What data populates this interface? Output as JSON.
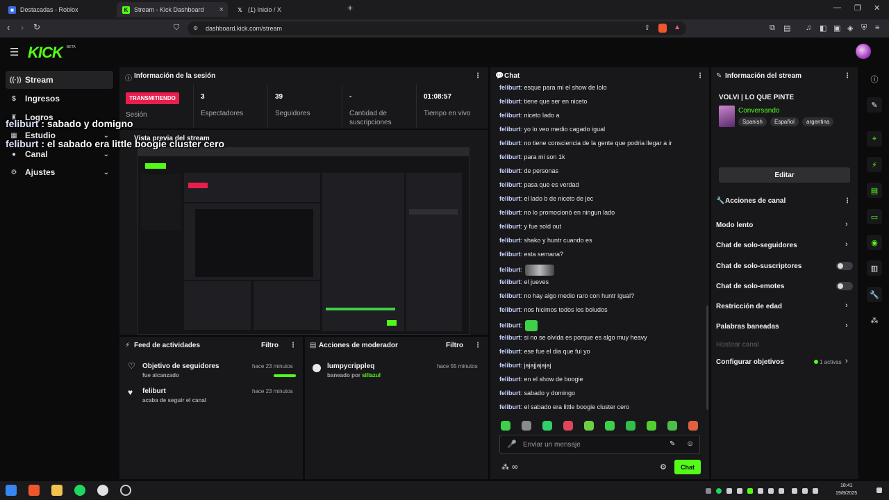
{
  "browser": {
    "tabs": [
      {
        "title": "Destacadas - Roblox"
      },
      {
        "title": "Stream - Kick Dashboard"
      },
      {
        "title": "(1) Inicio / X"
      }
    ],
    "new_tab_symbol": "+",
    "url": "dashboard.kick.com/stream"
  },
  "header": {
    "logo": "KICK",
    "beta": "BETA"
  },
  "sidebar": {
    "items": [
      {
        "label": "Stream",
        "icon": "broadcast-icon"
      },
      {
        "label": "Ingresos",
        "icon": "money-icon"
      },
      {
        "label": "Logros",
        "icon": "trophy-icon"
      },
      {
        "label": "Estudio",
        "icon": "studio-icon"
      },
      {
        "label": "Canal",
        "icon": "user-icon"
      },
      {
        "label": "Ajustes",
        "icon": "gear-icon"
      }
    ]
  },
  "overlay": {
    "lines": [
      {
        "user": "feliburt",
        "text": " : sabado y domigno"
      },
      {
        "user": "feliburt",
        "text": " : el sabado era little boogie cluster cero"
      }
    ]
  },
  "session": {
    "title": "Información de la sesión",
    "live_badge": "TRANSMITIENDO",
    "session_label": "Sesión",
    "stats": [
      {
        "value": "3",
        "label": "Espectadores"
      },
      {
        "value": "39",
        "label": "Seguidores"
      },
      {
        "value": "-",
        "label": "Cantidad de suscripciones"
      },
      {
        "value": "01:08:57",
        "label": "Tiempo en vivo"
      }
    ],
    "preview_title": "Vista previa del stream"
  },
  "activity": {
    "title": "Feed de actividades",
    "filter": "Filtro",
    "items": [
      {
        "title": "Objetivo de seguidores",
        "sub": "fue alcanzado",
        "time": "hace 23 minutos",
        "progress": 1.0
      },
      {
        "title": "feliburt",
        "sub": "acaba de seguir el canal",
        "time": "hace 23 minutos"
      }
    ]
  },
  "moderator": {
    "title": "Acciones de moderador",
    "filter": "Filtro",
    "items": [
      {
        "title": "lumpycrippleq",
        "sub_prefix": "baneado por ",
        "by": "sillazul",
        "time": "hace 55 minutos"
      }
    ]
  },
  "chat": {
    "title": "Chat",
    "messages": [
      {
        "user": "feliburt",
        "text": ": esque para mi el show de lolo"
      },
      {
        "user": "feliburt",
        "text": ": tiene que ser en niceto"
      },
      {
        "user": "feliburt",
        "text": ": niceto lado a"
      },
      {
        "user": "feliburt",
        "text": ": yo lo veo medio cagado igual"
      },
      {
        "user": "feliburt",
        "text": ": no tiene consciencia de la gente que podria llegar a ir"
      },
      {
        "user": "feliburt",
        "text": ": para mi son 1k"
      },
      {
        "user": "feliburt",
        "text": ": de personas"
      },
      {
        "user": "feliburt",
        "text": ": pasa que es verdad"
      },
      {
        "user": "feliburt",
        "text": ": el lado b de niceto de jec"
      },
      {
        "user": "feliburt",
        "text": ": no lo promocionó en ningun lado"
      },
      {
        "user": "feliburt",
        "text": ": y fue sold out"
      },
      {
        "user": "feliburt",
        "text": ": shako y huntr cuando es"
      },
      {
        "user": "feliburt",
        "text": ": esta semana?"
      },
      {
        "user": "feliburt",
        "text": ":",
        "emote": "image"
      },
      {
        "user": "feliburt",
        "text": ": el jueves"
      },
      {
        "user": "feliburt",
        "text": ": no hay algo medio raro con huntr igual?"
      },
      {
        "user": "feliburt",
        "text": ": nos hicimos todos los boludos"
      },
      {
        "user": "feliburt",
        "text": ":",
        "emote": "frog"
      },
      {
        "user": "feliburt",
        "text": ": si no se olvida es porque es algo muy heavy"
      },
      {
        "user": "feliburt",
        "text": ": ese fue el dia que fui yo"
      },
      {
        "user": "feliburt",
        "text": ": jajajjajajaj"
      },
      {
        "user": "feliburt",
        "text": ": en el show de boogie"
      },
      {
        "user": "feliburt",
        "text": ": sabado y domingo"
      },
      {
        "user": "feliburt",
        "text": ": el sabado era little boogie cluster cero"
      }
    ],
    "emote_colors": [
      "#3fd04a",
      "#8a8a8a",
      "#2fd06a",
      "#e0455a",
      "#6ad040",
      "#3fd04a",
      "#2fc04a",
      "#53d030",
      "#4ac04a",
      "#e06040"
    ],
    "input_placeholder": "Enviar un mensaje",
    "send_label": "Chat"
  },
  "stream_info": {
    "title": "Información del stream",
    "stream_title": "VOLVI | LO QUE PINTE",
    "category": "Conversando",
    "tags": [
      "Spanish",
      "Español",
      "argentina"
    ],
    "edit_label": "Editar"
  },
  "channel_actions": {
    "title": "Acciones de canal",
    "items": [
      {
        "label": "Modo lento",
        "control": "chevron"
      },
      {
        "label": "Chat de solo-seguidores",
        "control": "chevron"
      },
      {
        "label": "Chat de solo-suscriptores",
        "control": "toggle"
      },
      {
        "label": "Chat de solo-emotes",
        "control": "toggle"
      },
      {
        "label": "Restricción de edad",
        "control": "chevron"
      },
      {
        "label": "Palabras baneadas",
        "control": "chevron"
      },
      {
        "label": "Hostear canal",
        "control": "disabled"
      },
      {
        "label": "Configurar objetivos",
        "control": "chevron",
        "badge": "1 activas"
      }
    ]
  },
  "taskbar": {
    "time": "18:41",
    "date": "19/8/2025"
  },
  "colors": {
    "accent": "#53fc18",
    "live": "#e91e4f",
    "panel": "#18181b",
    "bg": "#0b0b0c"
  }
}
